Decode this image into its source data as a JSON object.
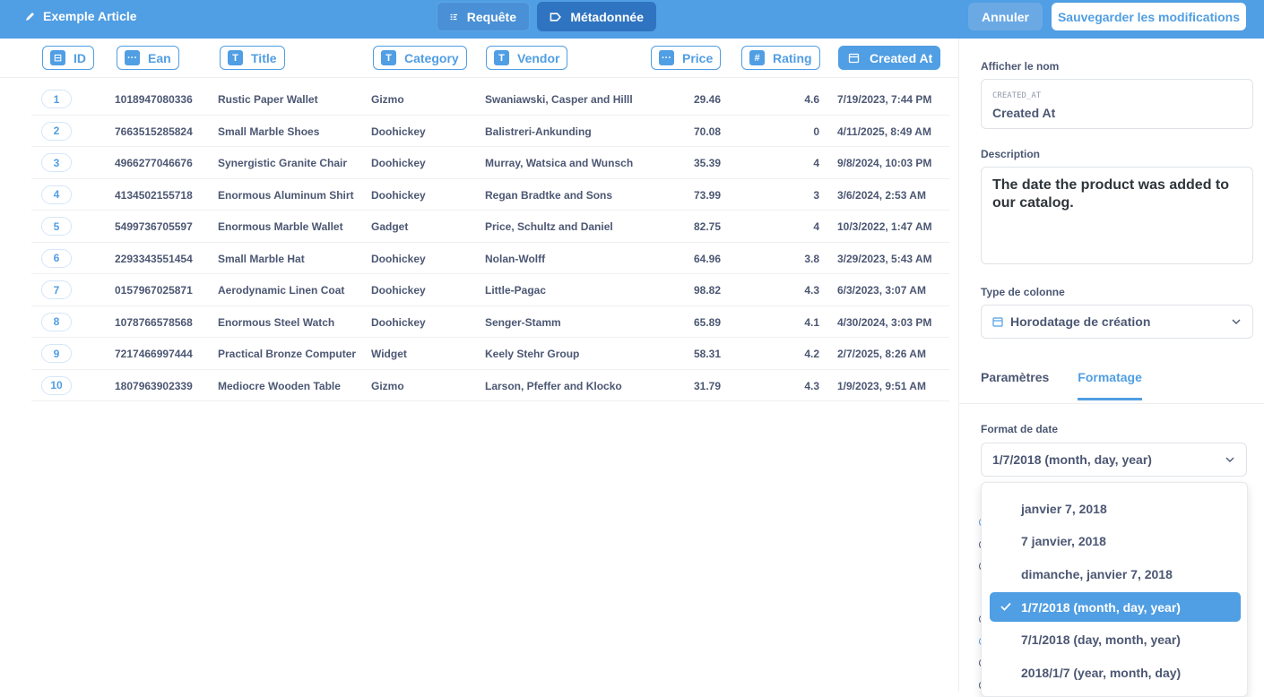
{
  "topbar": {
    "title": "Exemple Article",
    "seg_query": "Requête",
    "seg_meta": "Métadonnée",
    "cancel": "Annuler",
    "save": "Sauvegarder les modifications"
  },
  "columns": [
    {
      "label": "ID",
      "icon": "id-icon"
    },
    {
      "label": "Ean",
      "icon": "dots-icon"
    },
    {
      "label": "Title",
      "icon": "text-icon"
    },
    {
      "label": "Category",
      "icon": "text-icon"
    },
    {
      "label": "Vendor",
      "icon": "text-icon"
    },
    {
      "label": "Price",
      "icon": "dots-icon"
    },
    {
      "label": "Rating",
      "icon": "hash-icon"
    },
    {
      "label": "Created At",
      "icon": "calendar-icon"
    }
  ],
  "rows": [
    [
      "1",
      "1018947080336",
      "Rustic Paper Wallet",
      "Gizmo",
      "Swaniawski, Casper and Hilll",
      "29.46",
      "4.6",
      "7/19/2023, 7:44 PM"
    ],
    [
      "2",
      "7663515285824",
      "Small Marble Shoes",
      "Doohickey",
      "Balistreri-Ankunding",
      "70.08",
      "0",
      "4/11/2025, 8:49 AM"
    ],
    [
      "3",
      "4966277046676",
      "Synergistic Granite Chair",
      "Doohickey",
      "Murray, Watsica and Wunsch",
      "35.39",
      "4",
      "9/8/2024, 10:03 PM"
    ],
    [
      "4",
      "4134502155718",
      "Enormous Aluminum Shirt",
      "Doohickey",
      "Regan Bradtke and Sons",
      "73.99",
      "3",
      "3/6/2024, 2:53 AM"
    ],
    [
      "5",
      "5499736705597",
      "Enormous Marble Wallet",
      "Gadget",
      "Price, Schultz and Daniel",
      "82.75",
      "4",
      "10/3/2022, 1:47 AM"
    ],
    [
      "6",
      "2293343551454",
      "Small Marble Hat",
      "Doohickey",
      "Nolan-Wolff",
      "64.96",
      "3.8",
      "3/29/2023, 5:43 AM"
    ],
    [
      "7",
      "0157967025871",
      "Aerodynamic Linen Coat",
      "Doohickey",
      "Little-Pagac",
      "98.82",
      "4.3",
      "6/3/2023, 3:07 AM"
    ],
    [
      "8",
      "1078766578568",
      "Enormous Steel Watch",
      "Doohickey",
      "Senger-Stamm",
      "65.89",
      "4.1",
      "4/30/2024, 3:03 PM"
    ],
    [
      "9",
      "7217466997444",
      "Practical Bronze Computer",
      "Widget",
      "Keely Stehr Group",
      "58.31",
      "4.2",
      "2/7/2025, 8:26 AM"
    ],
    [
      "10",
      "1807963902339",
      "Mediocre Wooden Table",
      "Gizmo",
      "Larson, Pfeffer and Klocko",
      "31.79",
      "4.3",
      "1/9/2023, 9:51 AM"
    ]
  ],
  "panel": {
    "display_name_label": "Afficher le nom",
    "field_key": "CREATED_AT",
    "field_name": "Created At",
    "description_label": "Description",
    "description": "The date the product was added to our catalog.",
    "column_type_label": "Type de colonne",
    "column_type": "Horodatage de création",
    "tab_settings": "Paramètres",
    "tab_formatting": "Formatage",
    "date_format_label": "Format de date",
    "date_format_value": "1/7/2018 (month, day, year)"
  },
  "dropdown": {
    "options": [
      "janvier 7, 2018",
      "7 janvier, 2018",
      "dimanche, janvier 7, 2018",
      "1/7/2018 (month, day, year)",
      "7/1/2018 (day, month, year)",
      "2018/1/7 (year, month, day)"
    ],
    "selected_index": 3
  },
  "colors": {
    "accent": "#509ee3",
    "text": "#4c5773"
  }
}
